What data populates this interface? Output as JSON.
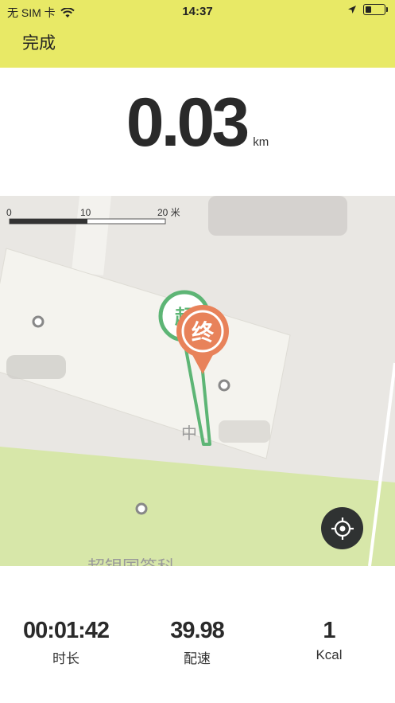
{
  "status_bar": {
    "carrier": "无 SIM 卡",
    "time": "14:37"
  },
  "nav": {
    "done_label": "完成"
  },
  "distance": {
    "value": "0.03",
    "unit": "km"
  },
  "map": {
    "scale_labels": [
      "0",
      "10",
      "20 米"
    ],
    "start_marker": "起",
    "end_marker": "终",
    "label_mid": "中",
    "label_bottom": "超银国签科",
    "route_color": "#5db575",
    "end_marker_color": "#e8825a"
  },
  "stats": [
    {
      "value": "00:01:42",
      "label": "时长"
    },
    {
      "value": "39.98",
      "label": "配速"
    },
    {
      "value": "1",
      "label": "Kcal"
    }
  ],
  "icons": {
    "wifi": "wifi-icon",
    "location_arrow": "location-arrow-icon",
    "battery": "battery-icon",
    "locate": "locate-icon"
  }
}
